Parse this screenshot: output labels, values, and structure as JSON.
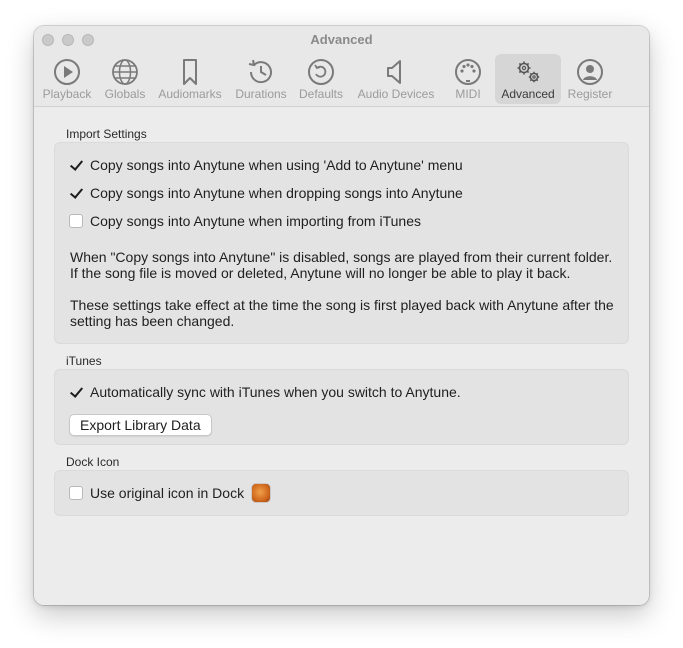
{
  "window": {
    "title": "Advanced"
  },
  "toolbar": {
    "items": [
      {
        "label": "Playback",
        "icon": "play-icon"
      },
      {
        "label": "Globals",
        "icon": "globe-icon"
      },
      {
        "label": "Audiomarks",
        "icon": "bookmark-icon"
      },
      {
        "label": "Durations",
        "icon": "history-icon"
      },
      {
        "label": "Defaults",
        "icon": "restore-icon"
      },
      {
        "label": "Audio Devices",
        "icon": "speaker-icon"
      },
      {
        "label": "MIDI",
        "icon": "midi-icon"
      },
      {
        "label": "Advanced",
        "icon": "gears-icon",
        "selected": true
      },
      {
        "label": "Register",
        "icon": "person-icon"
      }
    ]
  },
  "import_settings": {
    "title": "Import Settings",
    "options": [
      {
        "label": "Copy songs into Anytune when using 'Add to Anytune' menu",
        "checked": true
      },
      {
        "label": "Copy songs into Anytune when dropping songs into Anytune",
        "checked": true
      },
      {
        "label": "Copy songs into Anytune when importing from iTunes",
        "checked": false
      }
    ],
    "note1_line1": "When \"Copy songs into Anytune\" is disabled, songs are played from their current folder.",
    "note1_line2": "If the song file is moved or deleted, Anytune will no longer be able to play it back.",
    "note2_line1": "These settings take effect at the time the song is first played back with Anytune after the",
    "note2_line2": "setting has been changed."
  },
  "itunes": {
    "title": "iTunes",
    "sync_label": "Automatically sync with iTunes when you switch to Anytune.",
    "sync_checked": true,
    "export_button": "Export Library Data"
  },
  "dock_icon": {
    "title": "Dock Icon",
    "option_label": "Use original icon in Dock",
    "checked": false,
    "icon": "anytune-app-icon"
  }
}
